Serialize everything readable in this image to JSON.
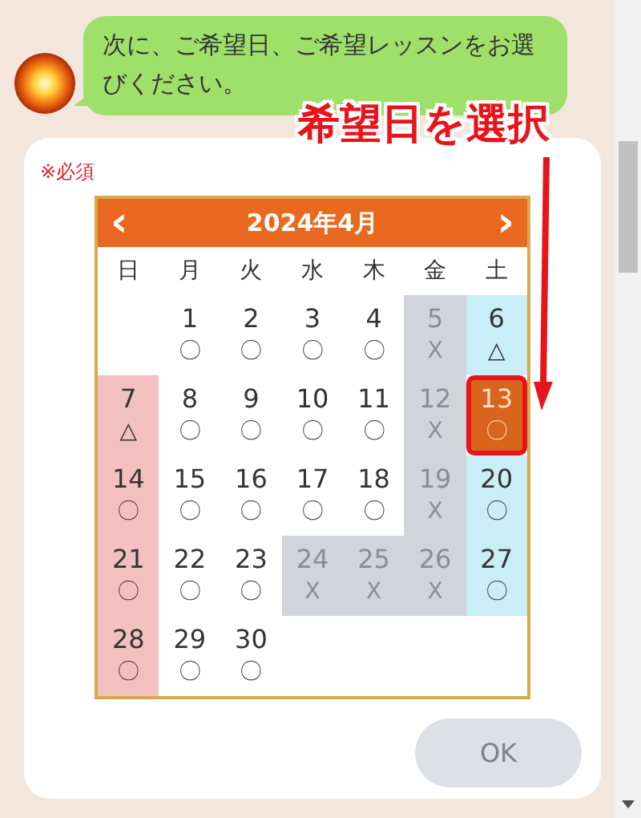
{
  "message": {
    "text": "次に、ご希望日、ご希望レッスンをお選びください。"
  },
  "form": {
    "required_label": "※必須",
    "calendar": {
      "title": "2024年4月",
      "prev": "‹",
      "next": "›",
      "weekdays": [
        "日",
        "月",
        "火",
        "水",
        "木",
        "金",
        "土"
      ],
      "weeks": [
        {
          "kind": "start",
          "days": [
            {
              "day": "1",
              "mark": "〇",
              "available": true,
              "selected": false
            },
            {
              "day": "2",
              "mark": "〇",
              "available": true,
              "selected": false
            },
            {
              "day": "3",
              "mark": "〇",
              "available": true,
              "selected": false
            },
            {
              "day": "4",
              "mark": "〇",
              "available": true,
              "selected": false
            },
            {
              "day": "5",
              "mark": "X",
              "available": false,
              "selected": false
            },
            {
              "day": "6",
              "mark": "△",
              "available": true,
              "selected": false
            }
          ]
        },
        {
          "kind": "full",
          "days": [
            {
              "day": "7",
              "mark": "△",
              "available": true,
              "selected": false
            },
            {
              "day": "8",
              "mark": "〇",
              "available": true,
              "selected": false
            },
            {
              "day": "9",
              "mark": "〇",
              "available": true,
              "selected": false
            },
            {
              "day": "10",
              "mark": "〇",
              "available": true,
              "selected": false
            },
            {
              "day": "11",
              "mark": "〇",
              "available": true,
              "selected": false
            },
            {
              "day": "12",
              "mark": "X",
              "available": false,
              "selected": false
            },
            {
              "day": "13",
              "mark": "〇",
              "available": true,
              "selected": true
            }
          ]
        },
        {
          "kind": "full",
          "days": [
            {
              "day": "14",
              "mark": "〇",
              "available": true,
              "selected": false
            },
            {
              "day": "15",
              "mark": "〇",
              "available": true,
              "selected": false
            },
            {
              "day": "16",
              "mark": "〇",
              "available": true,
              "selected": false
            },
            {
              "day": "17",
              "mark": "〇",
              "available": true,
              "selected": false
            },
            {
              "day": "18",
              "mark": "〇",
              "available": true,
              "selected": false
            },
            {
              "day": "19",
              "mark": "X",
              "available": false,
              "selected": false
            },
            {
              "day": "20",
              "mark": "〇",
              "available": true,
              "selected": false
            }
          ]
        },
        {
          "kind": "full",
          "days": [
            {
              "day": "21",
              "mark": "〇",
              "available": true,
              "selected": false
            },
            {
              "day": "22",
              "mark": "〇",
              "available": true,
              "selected": false
            },
            {
              "day": "23",
              "mark": "〇",
              "available": true,
              "selected": false
            },
            {
              "day": "24",
              "mark": "X",
              "available": false,
              "selected": false
            },
            {
              "day": "25",
              "mark": "X",
              "available": false,
              "selected": false
            },
            {
              "day": "26",
              "mark": "X",
              "available": false,
              "selected": false
            },
            {
              "day": "27",
              "mark": "〇",
              "available": true,
              "selected": false
            }
          ]
        },
        {
          "kind": "end",
          "days": [
            {
              "day": "28",
              "mark": "〇",
              "available": true,
              "selected": false
            },
            {
              "day": "29",
              "mark": "〇",
              "available": true,
              "selected": false
            },
            {
              "day": "30",
              "mark": "〇",
              "available": true,
              "selected": false
            }
          ]
        }
      ]
    },
    "ok_button": {
      "label": "OK",
      "disabled": true
    }
  },
  "annotation": {
    "label": "希望日を選択"
  }
}
